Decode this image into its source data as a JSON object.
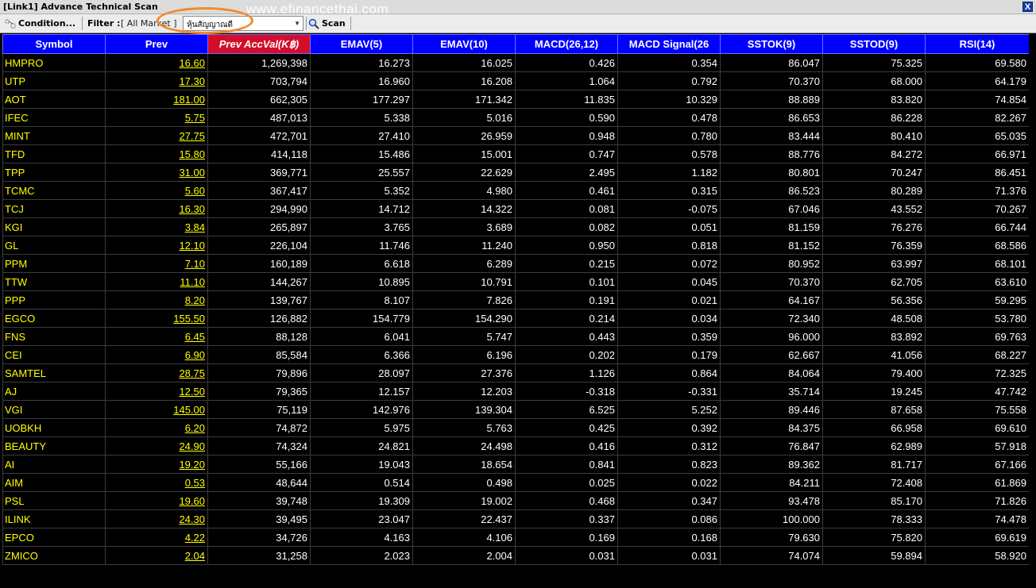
{
  "window": {
    "title": "[Link1] Advance Technical Scan",
    "watermark": "www.efinancethai.com",
    "close_label": "X"
  },
  "toolbar": {
    "condition_label": "Condition...",
    "filter_label": "Filter :",
    "filter_value": "[ All Market ]",
    "combo_value": "หุ้นสัญญาณดี",
    "combo_arrow": "▼",
    "scan_label": "Scan"
  },
  "colors": {
    "header_bg": "#0000ff",
    "sorted_header_bg": "#d40e2a",
    "symbol_text": "#ffff00",
    "highlight_oval": "#f08a2c"
  },
  "table": {
    "columns": [
      "Symbol",
      "Prev",
      "Prev AccVal(K฿)",
      "EMAV(5)",
      "EMAV(10)",
      "MACD(26,12)",
      "MACD Signal(26",
      "SSTOK(9)",
      "SSTOD(9)",
      "RSI(14)"
    ],
    "sorted_column": "Prev AccVal(K฿)",
    "rows": [
      [
        "HMPRO",
        "16.60",
        "1,269,398",
        "16.273",
        "16.025",
        "0.426",
        "0.354",
        "86.047",
        "75.325",
        "69.580"
      ],
      [
        "UTP",
        "17.30",
        "703,794",
        "16.960",
        "16.208",
        "1.064",
        "0.792",
        "70.370",
        "68.000",
        "64.179"
      ],
      [
        "AOT",
        "181.00",
        "662,305",
        "177.297",
        "171.342",
        "11.835",
        "10.329",
        "88.889",
        "83.820",
        "74.854"
      ],
      [
        "IFEC",
        "5.75",
        "487,013",
        "5.338",
        "5.016",
        "0.590",
        "0.478",
        "86.653",
        "86.228",
        "82.267"
      ],
      [
        "MINT",
        "27.75",
        "472,701",
        "27.410",
        "26.959",
        "0.948",
        "0.780",
        "83.444",
        "80.410",
        "65.035"
      ],
      [
        "TFD",
        "15.80",
        "414,118",
        "15.486",
        "15.001",
        "0.747",
        "0.578",
        "88.776",
        "84.272",
        "66.971"
      ],
      [
        "TPP",
        "31.00",
        "369,771",
        "25.557",
        "22.629",
        "2.495",
        "1.182",
        "80.801",
        "70.247",
        "86.451"
      ],
      [
        "TCMC",
        "5.60",
        "367,417",
        "5.352",
        "4.980",
        "0.461",
        "0.315",
        "86.523",
        "80.289",
        "71.376"
      ],
      [
        "TCJ",
        "16.30",
        "294,990",
        "14.712",
        "14.322",
        "0.081",
        "-0.075",
        "67.046",
        "43.552",
        "70.267"
      ],
      [
        "KGI",
        "3.84",
        "265,897",
        "3.765",
        "3.689",
        "0.082",
        "0.051",
        "81.159",
        "76.276",
        "66.744"
      ],
      [
        "GL",
        "12.10",
        "226,104",
        "11.746",
        "11.240",
        "0.950",
        "0.818",
        "81.152",
        "76.359",
        "68.586"
      ],
      [
        "PPM",
        "7.10",
        "160,189",
        "6.618",
        "6.289",
        "0.215",
        "0.072",
        "80.952",
        "63.997",
        "68.101"
      ],
      [
        "TTW",
        "11.10",
        "144,267",
        "10.895",
        "10.791",
        "0.101",
        "0.045",
        "70.370",
        "62.705",
        "63.610"
      ],
      [
        "PPP",
        "8.20",
        "139,767",
        "8.107",
        "7.826",
        "0.191",
        "0.021",
        "64.167",
        "56.356",
        "59.295"
      ],
      [
        "EGCO",
        "155.50",
        "126,882",
        "154.779",
        "154.290",
        "0.214",
        "0.034",
        "72.340",
        "48.508",
        "53.780"
      ],
      [
        "FNS",
        "6.45",
        "88,128",
        "6.041",
        "5.747",
        "0.443",
        "0.359",
        "96.000",
        "83.892",
        "69.763"
      ],
      [
        "CEI",
        "6.90",
        "85,584",
        "6.366",
        "6.196",
        "0.202",
        "0.179",
        "62.667",
        "41.056",
        "68.227"
      ],
      [
        "SAMTEL",
        "28.75",
        "79,896",
        "28.097",
        "27.376",
        "1.126",
        "0.864",
        "84.064",
        "79.400",
        "72.325"
      ],
      [
        "AJ",
        "12.50",
        "79,365",
        "12.157",
        "12.203",
        "-0.318",
        "-0.331",
        "35.714",
        "19.245",
        "47.742"
      ],
      [
        "VGI",
        "145.00",
        "75,119",
        "142.976",
        "139.304",
        "6.525",
        "5.252",
        "89.446",
        "87.658",
        "75.558"
      ],
      [
        "UOBKH",
        "6.20",
        "74,872",
        "5.975",
        "5.763",
        "0.425",
        "0.392",
        "84.375",
        "66.958",
        "69.610"
      ],
      [
        "BEAUTY",
        "24.90",
        "74,324",
        "24.821",
        "24.498",
        "0.416",
        "0.312",
        "76.847",
        "62.989",
        "57.918"
      ],
      [
        "AI",
        "19.20",
        "55,166",
        "19.043",
        "18.654",
        "0.841",
        "0.823",
        "89.362",
        "81.717",
        "67.166"
      ],
      [
        "AIM",
        "0.53",
        "48,644",
        "0.514",
        "0.498",
        "0.025",
        "0.022",
        "84.211",
        "72.408",
        "61.869"
      ],
      [
        "PSL",
        "19.60",
        "39,748",
        "19.309",
        "19.002",
        "0.468",
        "0.347",
        "93.478",
        "85.170",
        "71.826"
      ],
      [
        "ILINK",
        "24.30",
        "39,495",
        "23.047",
        "22.437",
        "0.337",
        "0.086",
        "100.000",
        "78.333",
        "74.478"
      ],
      [
        "EPCO",
        "4.22",
        "34,726",
        "4.163",
        "4.106",
        "0.169",
        "0.168",
        "79.630",
        "75.820",
        "69.619"
      ],
      [
        "ZMICO",
        "2.04",
        "31,258",
        "2.023",
        "2.004",
        "0.031",
        "0.031",
        "74.074",
        "59.894",
        "58.920"
      ]
    ]
  }
}
